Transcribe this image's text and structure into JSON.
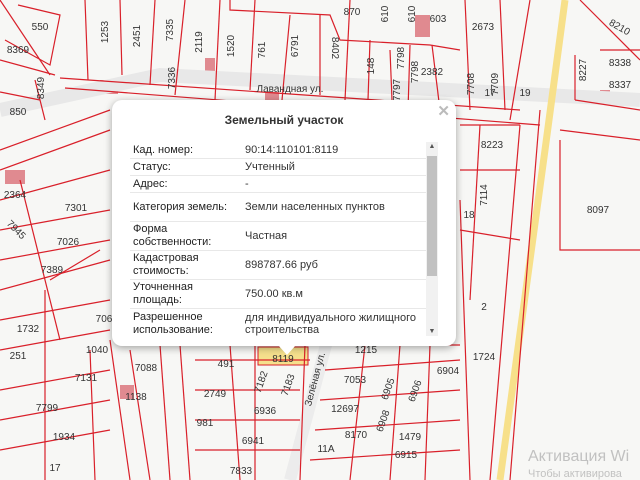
{
  "map": {
    "street_labels": [
      "Лавандная ул.",
      "Зелёная ул."
    ],
    "parcel_labels": [
      "550",
      "8369",
      "850",
      "8349",
      "1253",
      "2451",
      "7335",
      "7336",
      "2119",
      "1520",
      "761",
      "6791",
      "8402",
      "148",
      "7798",
      "7798",
      "7797",
      "870",
      "610",
      "610",
      "603",
      "2673",
      "2382",
      "7708",
      "7709",
      "8210",
      "8227",
      "8338",
      "8337",
      "8223",
      "7114",
      "8097",
      "18",
      "2364",
      "7301",
      "7945",
      "7026",
      "7389",
      "1732",
      "251",
      "1040",
      "7131",
      "7088",
      "1138",
      "7799",
      "1934",
      "491",
      "8119",
      "7182",
      "7183",
      "2749",
      "6936",
      "981",
      "6941",
      "7833",
      "1215",
      "6904",
      "7053",
      "12697",
      "6905",
      "6906",
      "6908",
      "8170",
      "6915",
      "11А",
      "1479",
      "1724",
      "2",
      "17",
      "19",
      "17",
      "706"
    ],
    "colors": {
      "parcel_border": "#d9202a",
      "highway": "#f7e08a",
      "selected_parcel": "#f5e08c",
      "background": "#f7f7f5"
    }
  },
  "popup": {
    "title": "Земельный участок",
    "close_icon": "close-icon",
    "rows": [
      {
        "key": "Кад. номер:",
        "value": "90:14:110101:8119"
      },
      {
        "key": "Статус:",
        "value": "Учтенный"
      },
      {
        "key": "Адрес:",
        "value": "-"
      },
      {
        "key": "Категория земель:",
        "value": "Земли населенных пунктов"
      },
      {
        "key": "Форма собственности:",
        "value": "Частная"
      },
      {
        "key": "Кадастровая стоимость:",
        "value": "898787.66 руб"
      },
      {
        "key": "Уточненная площадь:",
        "value": "750.00 кв.м"
      },
      {
        "key": "Разрешенное использование:",
        "value": "для индивидуального жилищного строительства"
      }
    ]
  },
  "watermark": {
    "line1": "Активация Wi",
    "line2": "Чтобы активирова"
  }
}
